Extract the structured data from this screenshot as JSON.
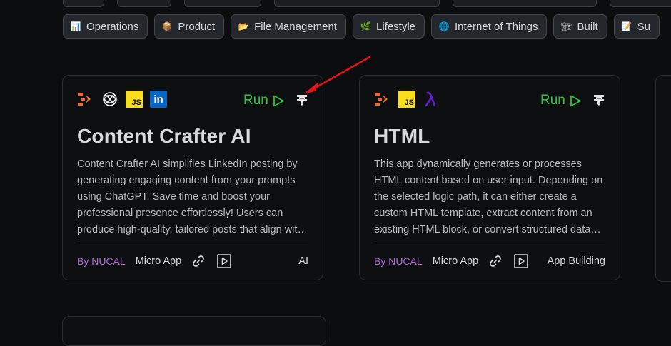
{
  "categories": [
    {
      "label": "Operations",
      "icon": "bar-chart-icon",
      "glyph": "📊"
    },
    {
      "label": "Product",
      "icon": "package-icon",
      "glyph": "📦"
    },
    {
      "label": "File Management",
      "icon": "folder-icon",
      "glyph": "📂"
    },
    {
      "label": "Lifestyle",
      "icon": "leaf-icon",
      "glyph": "🌿"
    },
    {
      "label": "Internet of Things",
      "icon": "globe-icon",
      "glyph": "🌐"
    },
    {
      "label": "Built",
      "icon": "construction-icon",
      "glyph": "🏗"
    },
    {
      "label": "Su",
      "icon": "memo-icon",
      "glyph": "📝"
    }
  ],
  "cards": [
    {
      "title": "Content Crafter AI",
      "description": "Content Crafter AI simplifies LinkedIn posting by generating engaging content from your prompts using ChatGPT. Save time and boost your professional presence effortlessly! Users can produce high-quality, tailored posts that align with their professional goals.",
      "run_label": "Run",
      "author": "By NUCAL",
      "type": "Micro App",
      "category": "AI",
      "icons": [
        "nucal-logo-icon",
        "openai-icon",
        "javascript-icon",
        "linkedin-icon"
      ],
      "js_text": "JS",
      "li_text": "in"
    },
    {
      "title": "HTML",
      "description": "This app dynamically generates or processes HTML content based on user input. Depending on the selected logic path, it can either create a custom HTML template, extract content from an existing HTML block, or convert structured data into markup.",
      "run_label": "Run",
      "author": "By NUCAL",
      "type": "Micro App",
      "category": "App Building",
      "icons": [
        "nucal-logo-icon",
        "javascript-icon",
        "lambda-icon"
      ],
      "js_text": "JS"
    }
  ],
  "colors": {
    "run": "#2fc23e",
    "author": "#b36bdb",
    "annotation_arrow": "#e0141b",
    "js_badge": "#f7df1e",
    "linkedin": "#0a66c2",
    "lambda": "#6a1fd1",
    "nucal": "#f26b1d"
  }
}
